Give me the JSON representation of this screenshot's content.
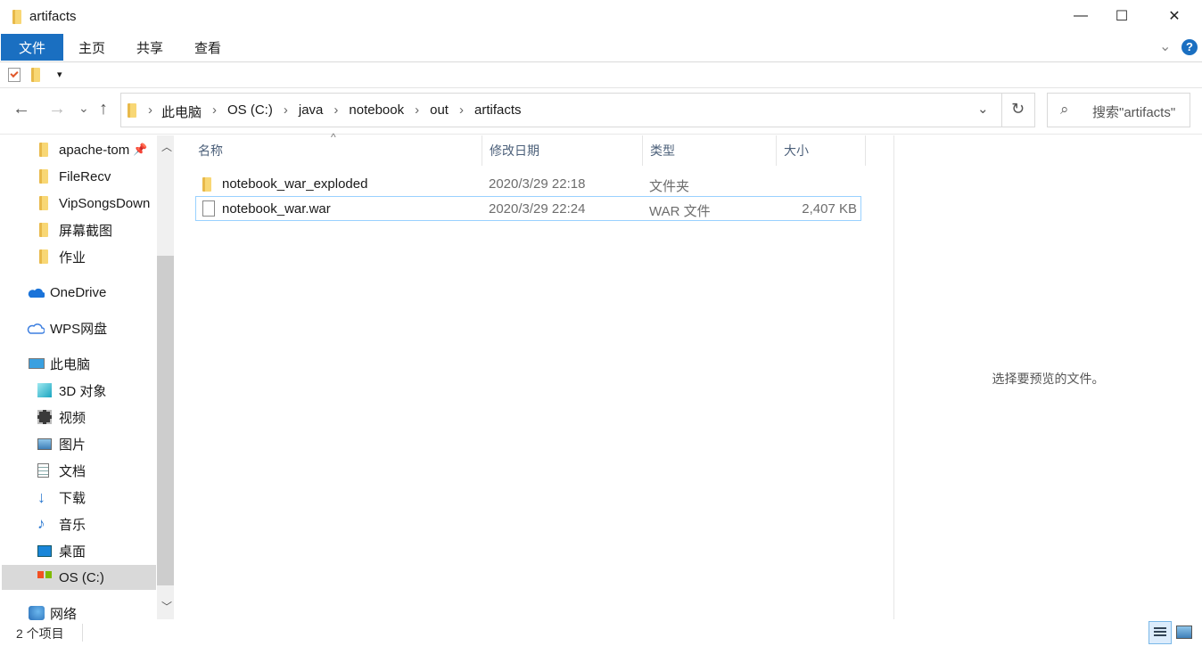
{
  "window": {
    "title": "artifacts",
    "minimize": "—",
    "maximize": "☐",
    "close": "✕"
  },
  "ribbon": {
    "tabs": [
      "文件",
      "主页",
      "共享",
      "查看"
    ],
    "help": "?",
    "expand": "⌄"
  },
  "quick_access": {
    "dropdown": "▾"
  },
  "navigation": {
    "back": "←",
    "forward": "→",
    "recent": "⌄",
    "up": "↑",
    "refresh": "↻"
  },
  "address": {
    "segments": [
      "此电脑",
      "OS (C:)",
      "java",
      "notebook",
      "out",
      "artifacts"
    ],
    "separator": "›",
    "dropdown": "⌄"
  },
  "search": {
    "placeholder": "搜索\"artifacts\"",
    "icon": "⌕"
  },
  "sidebar": {
    "quick_items": [
      "apache-tom",
      "FileRecv",
      "VipSongsDown",
      "屏幕截图",
      "作业"
    ],
    "onedrive": "OneDrive",
    "wps": "WPS网盘",
    "this_pc": "此电脑",
    "pc_items": [
      "3D 对象",
      "视频",
      "图片",
      "文档",
      "下载",
      "音乐",
      "桌面",
      "OS (C:)"
    ],
    "network": "网络",
    "selected": "OS (C:)"
  },
  "columns": {
    "name": "名称",
    "modified": "修改日期",
    "type": "类型",
    "size": "大小",
    "sort_indicator": "^"
  },
  "files": [
    {
      "name": "notebook_war_exploded",
      "modified": "2020/3/29 22:18",
      "type": "文件夹",
      "size": "",
      "icon": "folder-icon"
    },
    {
      "name": "notebook_war.war",
      "modified": "2020/3/29 22:24",
      "type": "WAR 文件",
      "size": "2,407 KB",
      "icon": "file-icon"
    }
  ],
  "preview": {
    "message": "选择要预览的文件。"
  },
  "status": {
    "count": "2 个项目"
  },
  "colors": {
    "accent": "#1a6fc1",
    "selection_border": "#99d1ff",
    "nav_selected": "#d9d9d9"
  }
}
